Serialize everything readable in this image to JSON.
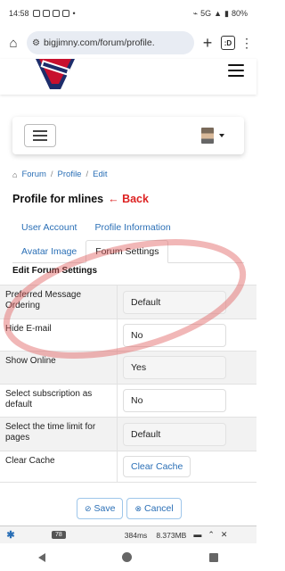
{
  "status_bar": {
    "time": "14:58",
    "signal_label": "5G",
    "battery": "80%"
  },
  "browser": {
    "url": "bigjimny.com/forum/profile.",
    "tab_count": ":D"
  },
  "breadcrumb": {
    "items": [
      "Forum",
      "Profile",
      "Edit"
    ],
    "separator": "/"
  },
  "page": {
    "title": "Profile for mlines",
    "back_label": "← Back"
  },
  "tabs": {
    "row1": [
      "User Account",
      "Profile Information"
    ],
    "row2": [
      "Avatar Image",
      "Forum Settings"
    ],
    "active": "Forum Settings"
  },
  "section_title": "Edit Forum Settings",
  "settings": [
    {
      "label": "Preferred Message Ordering",
      "value": "Default",
      "shaded": true
    },
    {
      "label": "Hide E-mail",
      "value": "No",
      "shaded": false
    },
    {
      "label": "Show Online",
      "value": "Yes",
      "shaded": true
    },
    {
      "label": "Select subscription as default",
      "value": "No",
      "shaded": false
    },
    {
      "label": "Select the time limit for pages",
      "value": "Default",
      "shaded": true
    },
    {
      "label": "Clear Cache",
      "button": "Clear Cache",
      "shaded": false
    }
  ],
  "actions": {
    "save": "Save",
    "cancel": "Cancel"
  },
  "debug_bar": {
    "count": "78",
    "time": "384ms",
    "memory": "8.373MB"
  },
  "colors": {
    "link": "#2a6fb6",
    "back": "#d22222",
    "annotation": "#e06060"
  }
}
